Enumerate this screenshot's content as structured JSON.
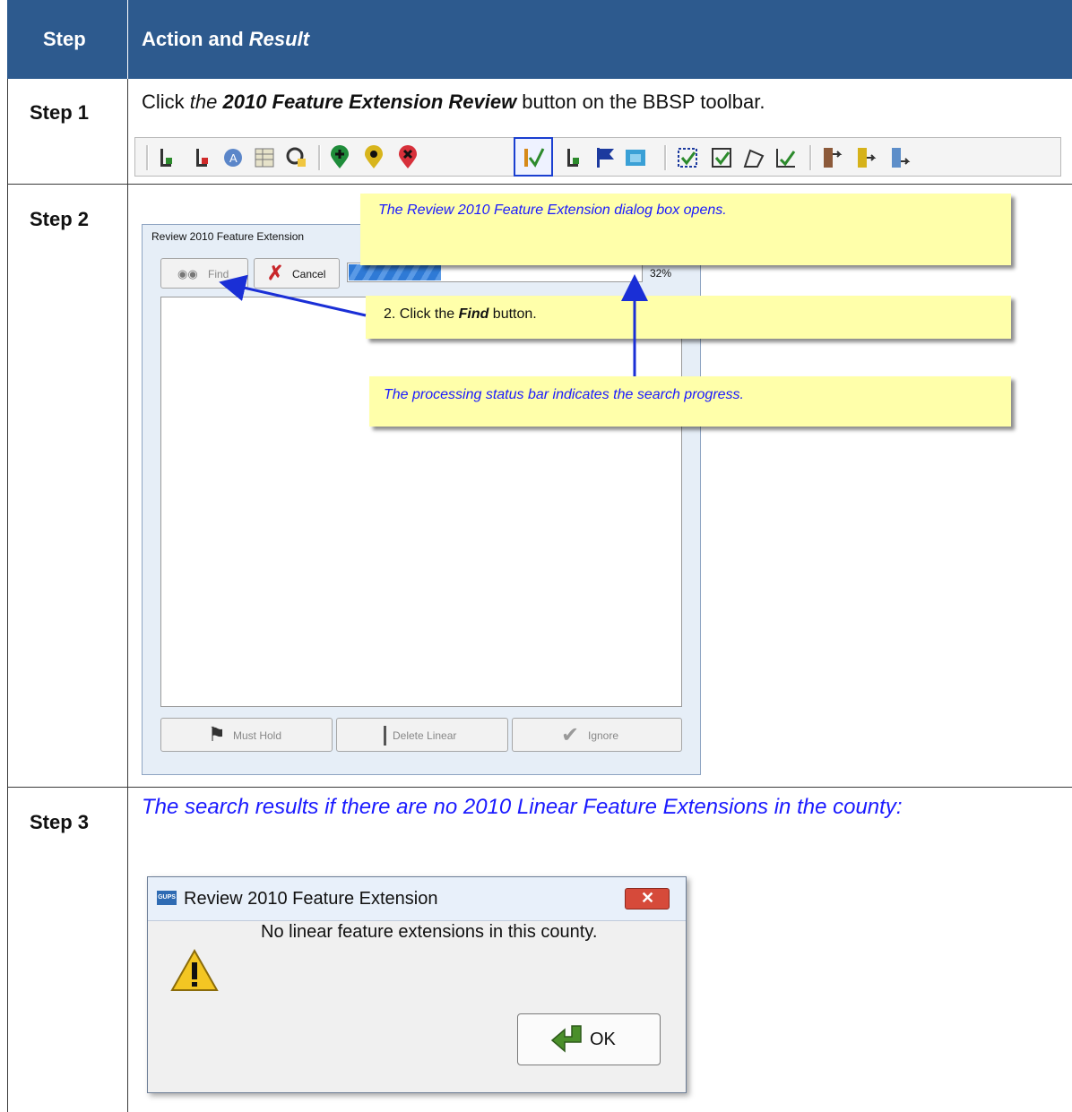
{
  "table": {
    "header": {
      "step": "Step",
      "action": "Action and ",
      "result": "Result"
    },
    "rows": [
      {
        "step": "Step 1",
        "text": {
          "the": "the ",
          "bold": "2010 Feature Extension Review",
          "rest": " button on the BBSP toolbar.",
          "click": "Click "
        }
      },
      {
        "step": "Step 2"
      },
      {
        "step": "Step 3",
        "text": "The search results if there are no 2010 Linear Feature Extensions in the county:"
      }
    ]
  },
  "toolbar": {
    "icons": [
      "linear-add-icon",
      "linear-delete-icon",
      "address-icon",
      "attribute-table-icon",
      "map-search-icon",
      "add-point-icon",
      "edit-point-icon",
      "delete-point-icon",
      "feature-extension-review-icon",
      "linear-flag-icon",
      "flag-icon",
      "image-icon",
      "select-extent-icon",
      "check-extent-icon",
      "polygon-icon",
      "check-icon",
      "export-icon",
      "export-yellow-icon",
      "export-blue-icon"
    ],
    "highlight_color": "#1a3fd0"
  },
  "review_dialog": {
    "title": "Review 2010 Feature Extension",
    "find_label": "Find",
    "cancel_label": "Cancel",
    "progress_fraction": 0.32,
    "progress_text": "32%",
    "must_hold_label": "Must Hold",
    "delete_linear_label": "Delete Linear",
    "ignore_label": "Ignore"
  },
  "callouts": {
    "opens": "The Review 2010 Feature Extension dialog box opens.",
    "click_pre": "2. Click the ",
    "click_bold": "Find",
    "click_post": " button.",
    "status": "The processing status bar indicates the search progress."
  },
  "message_box": {
    "app_badge": "GUPS",
    "title": "Review 2010 Feature Extension",
    "message": "No linear feature extensions in this county.",
    "ok_label": "OK"
  },
  "colors": {
    "header": "#2d5a8e",
    "callout": "#ffffaa",
    "italic_blue": "#1a1aff",
    "arrow": "#1a2fd6"
  }
}
